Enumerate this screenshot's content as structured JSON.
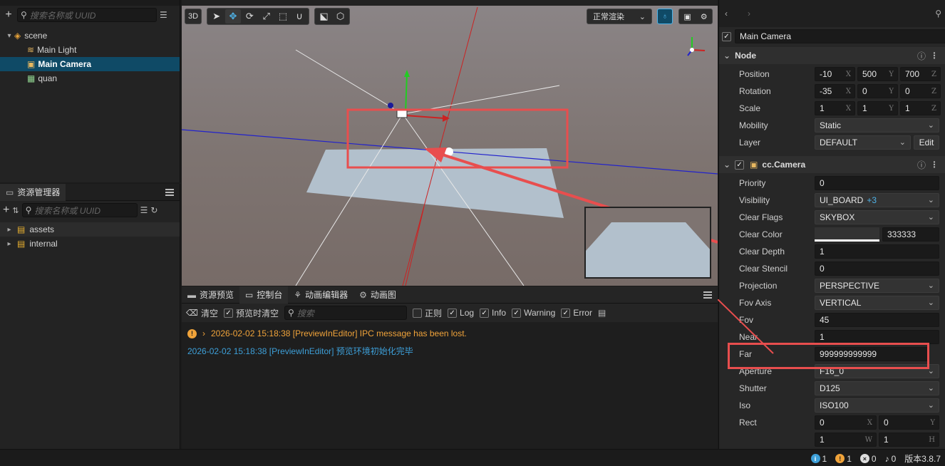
{
  "hierarchy": {
    "search_placeholder": "搜索名称或 UUID",
    "items": [
      {
        "label": "scene"
      },
      {
        "label": "Main Light"
      },
      {
        "label": "Main Camera"
      },
      {
        "label": "quan"
      }
    ]
  },
  "assets": {
    "tab_label": "资源管理器",
    "search_placeholder": "搜索名称或 UUID",
    "items": [
      {
        "label": "assets"
      },
      {
        "label": "internal"
      }
    ]
  },
  "scene_toolbar": {
    "mode_3d": "3D",
    "render_mode": "正常渲染"
  },
  "console": {
    "tabs": [
      {
        "label": "资源预览"
      },
      {
        "label": "控制台"
      },
      {
        "label": "动画编辑器"
      },
      {
        "label": "动画图"
      }
    ],
    "clear_label": "清空",
    "clear_on_preview_label": "预览时清空",
    "search_placeholder": "搜索",
    "regex_label": "正则",
    "filters": {
      "log": "Log",
      "info": "Info",
      "warning": "Warning",
      "error": "Error"
    },
    "messages": [
      {
        "text": "2026-02-02 15:18:38 [PreviewInEditor] IPC message has been lost.",
        "level": "warning"
      },
      {
        "text": "2026-02-02 15:18:38 [PreviewInEditor] 预览环境初始化完毕",
        "level": "info"
      }
    ]
  },
  "inspector": {
    "node_name": "Main Camera",
    "node_section": "Node",
    "position": {
      "label": "Position",
      "x": "-10",
      "y": "500",
      "z": "700"
    },
    "rotation": {
      "label": "Rotation",
      "x": "-35",
      "y": "0",
      "z": "0"
    },
    "scale": {
      "label": "Scale",
      "x": "1",
      "y": "1",
      "z": "1"
    },
    "mobility": {
      "label": "Mobility",
      "value": "Static"
    },
    "layer": {
      "label": "Layer",
      "value": "DEFAULT",
      "edit": "Edit"
    },
    "camera_section": "cc.Camera",
    "priority": {
      "label": "Priority",
      "value": "0"
    },
    "visibility": {
      "label": "Visibility",
      "value": "UI_BOARD",
      "extra": "+3"
    },
    "clear_flags": {
      "label": "Clear Flags",
      "value": "SKYBOX"
    },
    "clear_color": {
      "label": "Clear Color",
      "value": "333333"
    },
    "clear_depth": {
      "label": "Clear Depth",
      "value": "1"
    },
    "clear_stencil": {
      "label": "Clear Stencil",
      "value": "0"
    },
    "projection": {
      "label": "Projection",
      "value": "PERSPECTIVE"
    },
    "fov_axis": {
      "label": "Fov Axis",
      "value": "VERTICAL"
    },
    "fov": {
      "label": "Fov",
      "value": "45"
    },
    "near": {
      "label": "Near",
      "value": "1"
    },
    "far": {
      "label": "Far",
      "value": "999999999999"
    },
    "aperture": {
      "label": "Aperture",
      "value": "F16_0"
    },
    "shutter": {
      "label": "Shutter",
      "value": "D125"
    },
    "iso": {
      "label": "Iso",
      "value": "ISO100"
    },
    "rect": {
      "label": "Rect",
      "x": "0",
      "y": "0",
      "w": "1",
      "h": "1"
    }
  },
  "statusbar": {
    "info_count": "1",
    "warning_count": "1",
    "error_count": "0",
    "notify_count": "0",
    "version": "版本3.8.7"
  },
  "colors": {
    "accent_blue": "#4fb3e8",
    "selection": "#0f4a66",
    "annotation_red": "#e84e4e",
    "warning_text": "#f0a33a",
    "info_text": "#3d9fd8"
  }
}
